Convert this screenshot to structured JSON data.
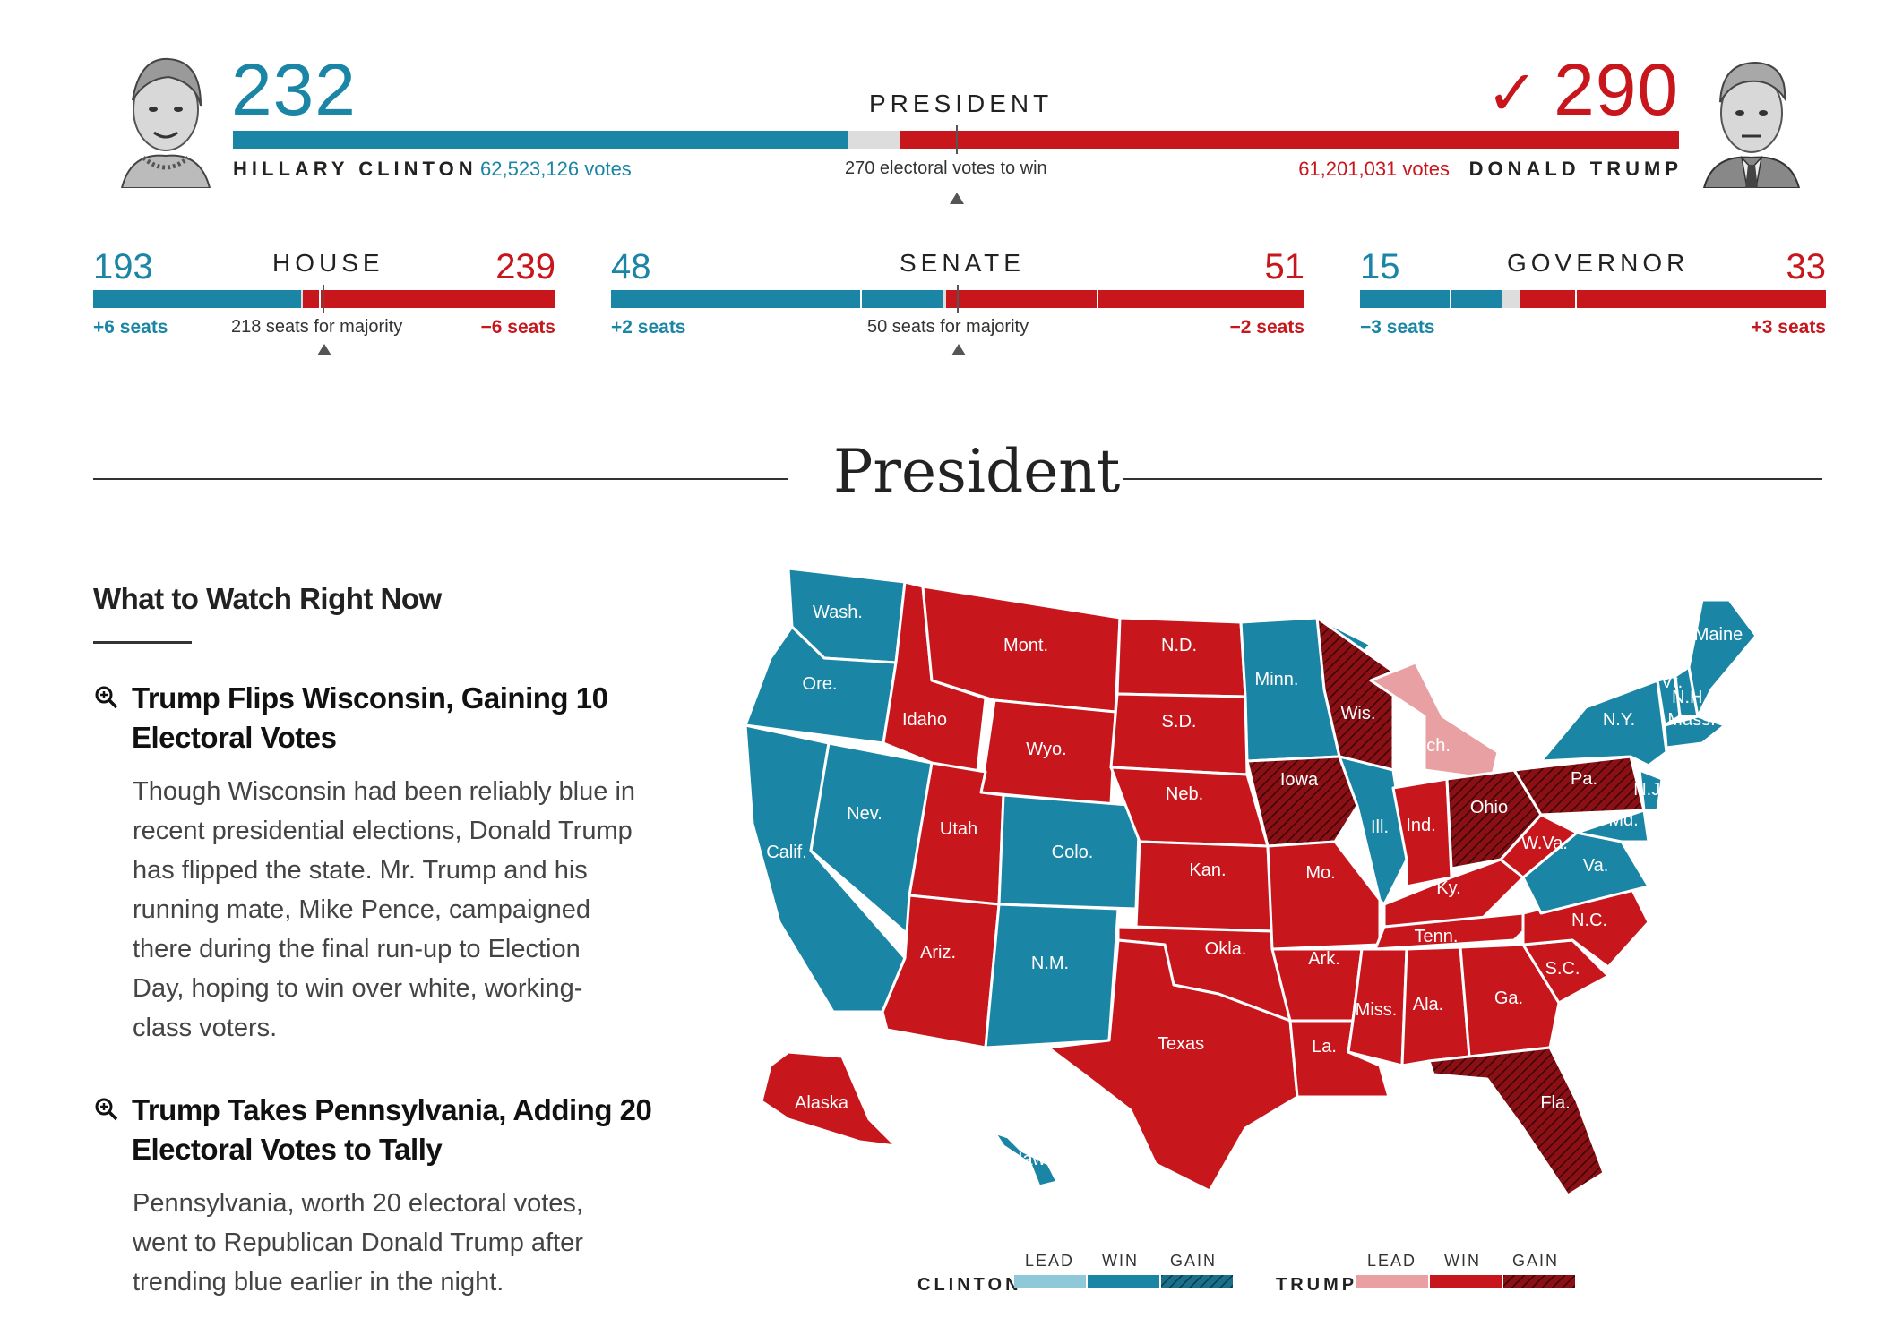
{
  "president": {
    "title": "PRESIDENT",
    "threshold_text": "270 electoral votes to win",
    "total_electoral": 538,
    "winner_check": "✓",
    "clinton": {
      "name": "HILLARY CLINTON",
      "electoral": "232",
      "electoral_value": 232,
      "votes": "62,523,126 votes",
      "color": "#1a85a4"
    },
    "trump": {
      "name": "DONALD TRUMP",
      "electoral": "290",
      "electoral_value": 290,
      "votes": "61,201,031 votes",
      "color": "#c8161d"
    }
  },
  "races": [
    {
      "title": "HOUSE",
      "dem": "193",
      "rep": "239",
      "dem_change": "+6 seats",
      "rep_change": "−6 seats",
      "majority_text": "218 seats for majority"
    },
    {
      "title": "SENATE",
      "dem": "48",
      "rep": "51",
      "dem_change": "+2 seats",
      "rep_change": "−2 seats",
      "majority_text": "50 seats for majority"
    },
    {
      "title": "GOVERNOR",
      "dem": "15",
      "rep": "33",
      "dem_change": "−3 seats",
      "rep_change": "+3 seats"
    }
  ],
  "section_title": "President",
  "watch": {
    "heading": "What to Watch Right Now",
    "items": [
      {
        "headline_line1": "Trump Flips Wisconsin, Gaining 10",
        "headline_line2": "Electoral Votes",
        "body": [
          "Though Wisconsin had been reliably blue in",
          "recent presidential elections, Donald Trump",
          "has flipped the state. Mr. Trump and his",
          "running mate, Mike Pence, campaigned",
          "there during the final run-up to Election",
          "Day, hoping to win over white, working-",
          "class voters."
        ]
      },
      {
        "headline_line1": "Trump Takes Pennsylvania, Adding 20",
        "headline_line2": "Electoral Votes to Tally",
        "body": [
          "Pennsylvania, worth 20 electoral votes,",
          "went to Republican Donald Trump after",
          "trending blue earlier in the night."
        ]
      }
    ]
  },
  "map": {
    "colors": {
      "clinton_win": "#1a85a4",
      "clinton_lead": "#8fc8d9",
      "trump_win": "#c8161d",
      "trump_lead": "#e8a0a2",
      "trump_gain": "#8b1015"
    },
    "states": [
      {
        "label": "Wash.",
        "status": "clinton_win"
      },
      {
        "label": "Ore.",
        "status": "clinton_win"
      },
      {
        "label": "Calif.",
        "status": "clinton_win"
      },
      {
        "label": "Nev.",
        "status": "clinton_win"
      },
      {
        "label": "Idaho",
        "status": "trump_win"
      },
      {
        "label": "Mont.",
        "status": "trump_win"
      },
      {
        "label": "Wyo.",
        "status": "trump_win"
      },
      {
        "label": "Utah",
        "status": "trump_win"
      },
      {
        "label": "Colo.",
        "status": "clinton_win"
      },
      {
        "label": "Ariz.",
        "status": "trump_win"
      },
      {
        "label": "N.M.",
        "status": "clinton_win"
      },
      {
        "label": "N.D.",
        "status": "trump_win"
      },
      {
        "label": "S.D.",
        "status": "trump_win"
      },
      {
        "label": "Neb.",
        "status": "trump_win"
      },
      {
        "label": "Kan.",
        "status": "trump_win"
      },
      {
        "label": "Okla.",
        "status": "trump_win"
      },
      {
        "label": "Texas",
        "status": "trump_win"
      },
      {
        "label": "Minn.",
        "status": "clinton_win"
      },
      {
        "label": "Iowa",
        "status": "trump_gain"
      },
      {
        "label": "Mo.",
        "status": "trump_win"
      },
      {
        "label": "Ark.",
        "status": "trump_win"
      },
      {
        "label": "La.",
        "status": "trump_win"
      },
      {
        "label": "Wis.",
        "status": "trump_gain"
      },
      {
        "label": "Ill.",
        "status": "clinton_win"
      },
      {
        "label": "Mich.",
        "status": "trump_lead"
      },
      {
        "label": "Ind.",
        "status": "trump_win"
      },
      {
        "label": "Ohio",
        "status": "trump_gain"
      },
      {
        "label": "Ky.",
        "status": "trump_win"
      },
      {
        "label": "Tenn.",
        "status": "trump_win"
      },
      {
        "label": "Miss.",
        "status": "trump_win"
      },
      {
        "label": "Ala.",
        "status": "trump_win"
      },
      {
        "label": "Ga.",
        "status": "trump_win"
      },
      {
        "label": "Fla.",
        "status": "trump_gain"
      },
      {
        "label": "S.C.",
        "status": "trump_win"
      },
      {
        "label": "N.C.",
        "status": "trump_win"
      },
      {
        "label": "Va.",
        "status": "clinton_win"
      },
      {
        "label": "W.Va.",
        "status": "trump_win"
      },
      {
        "label": "Pa.",
        "status": "trump_gain"
      },
      {
        "label": "N.Y.",
        "status": "clinton_win"
      },
      {
        "label": "N.J.",
        "status": "clinton_win"
      },
      {
        "label": "Md.",
        "status": "clinton_win"
      },
      {
        "label": "Vt.",
        "status": "clinton_win"
      },
      {
        "label": "N.H.",
        "status": "clinton_win"
      },
      {
        "label": "Mass.",
        "status": "clinton_win"
      },
      {
        "label": "Maine",
        "status": "clinton_win"
      },
      {
        "label": "Alaska",
        "status": "trump_win"
      },
      {
        "label": "Hawaii",
        "status": "clinton_win"
      }
    ]
  },
  "legend": {
    "clinton": "CLINTON",
    "trump": "TRUMP",
    "lead": "LEAD",
    "win": "WIN",
    "gain": "GAIN"
  }
}
